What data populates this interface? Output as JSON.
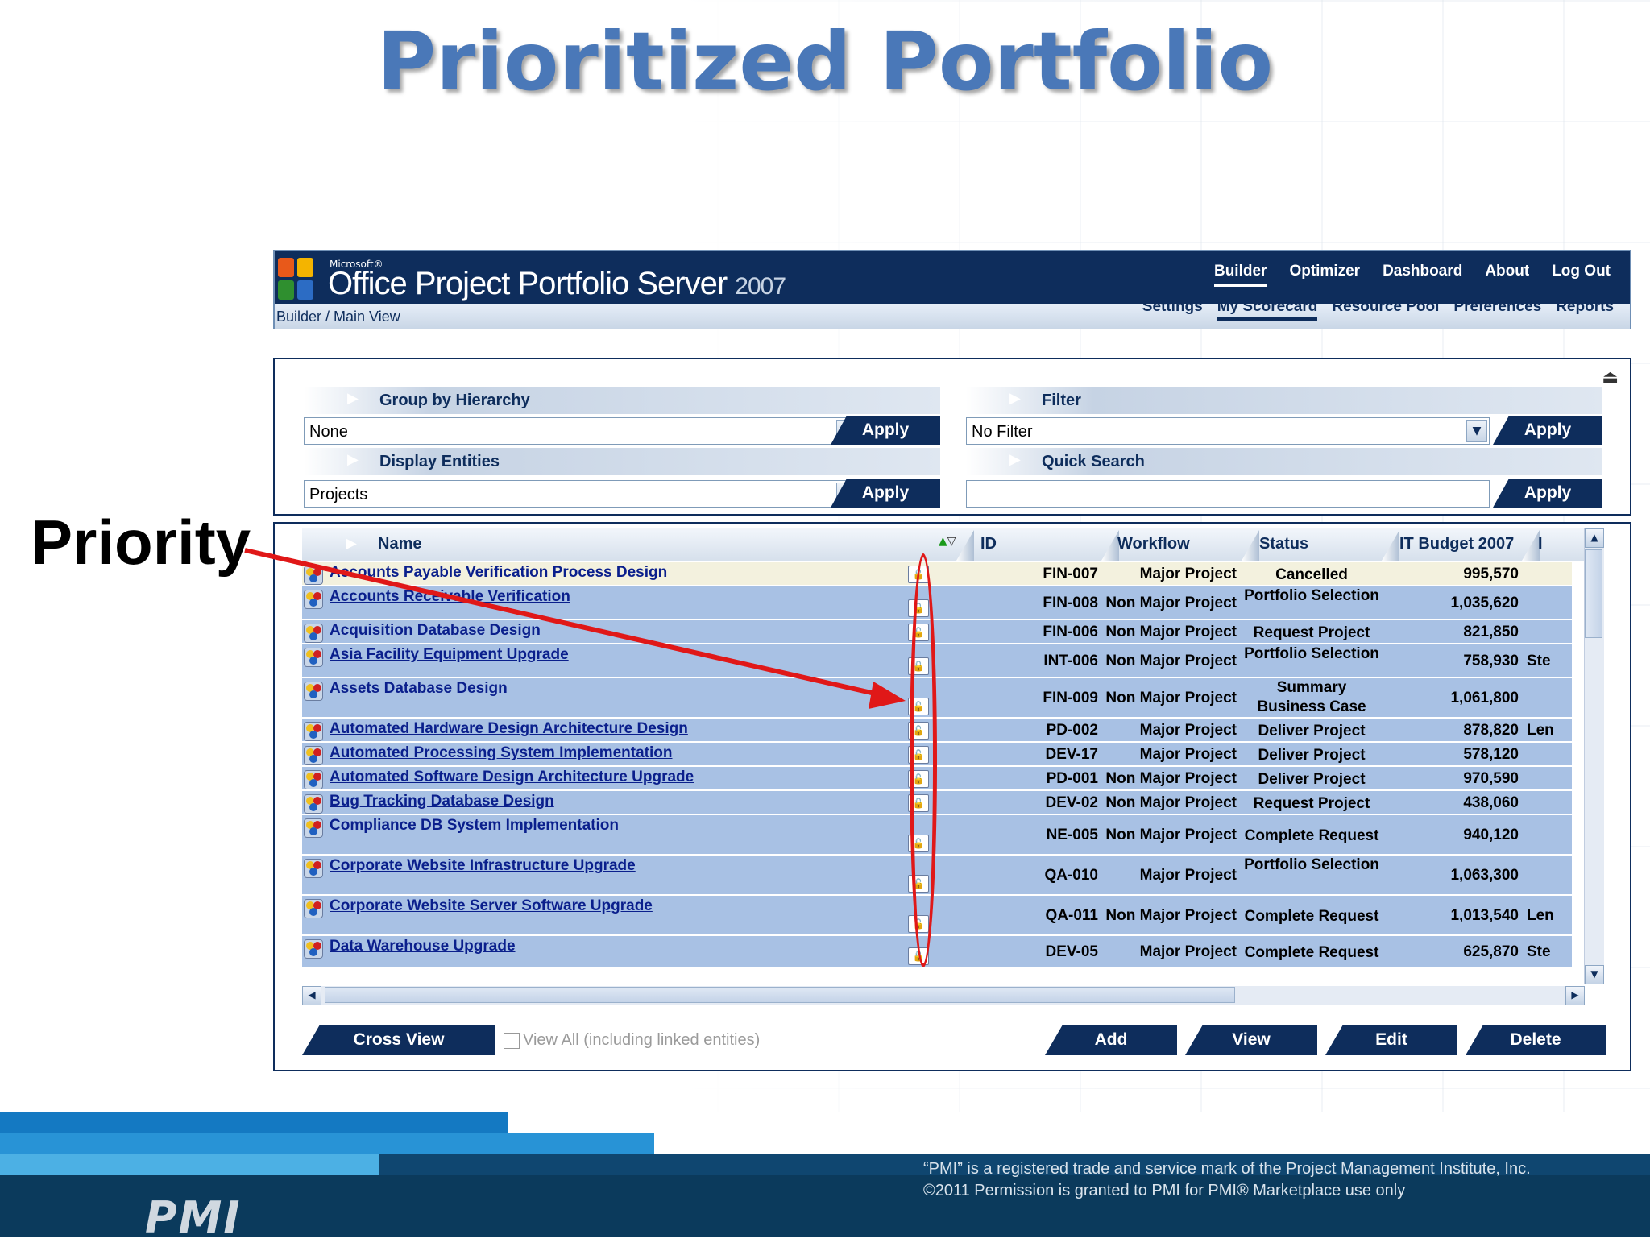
{
  "slide": {
    "title": "Prioritized Portfolio",
    "callout_label": "Priority",
    "footnote_line1": "“PMI” is a registered trade and service mark of the Project Management Institute, Inc.",
    "footnote_line2": "©2011 Permission is granted to PMI for PMI® Marketplace use only",
    "footer_logo": "PMI"
  },
  "app": {
    "vendor": "Microsoft®",
    "product": "Office Project Portfolio Server",
    "version": "2007",
    "breadcrumb": "Builder / Main View",
    "top_nav": [
      "Builder",
      "Optimizer",
      "Dashboard",
      "About",
      "Log Out"
    ],
    "top_nav_active": "Builder",
    "sub_nav": [
      "Settings",
      "My Scorecard",
      "Resource Pool",
      "Preferences",
      "Reports"
    ],
    "sub_nav_active": "My Scorecard"
  },
  "controls": {
    "group_by": {
      "label": "Group by Hierarchy",
      "value": "None",
      "apply": "Apply"
    },
    "filter": {
      "label": "Filter",
      "value": "No Filter",
      "apply": "Apply"
    },
    "display_entities": {
      "label": "Display Entities",
      "value": "Projects",
      "apply": "Apply"
    },
    "quick_search": {
      "label": "Quick Search",
      "value": "",
      "apply": "Apply"
    }
  },
  "grid": {
    "columns": [
      "Name",
      "ID",
      "Workflow",
      "Status",
      "IT Budget 2007",
      "I"
    ],
    "rows": [
      {
        "name": "Accounts Payable Verification Process Design",
        "id": "FIN-007",
        "workflow": "Major Project",
        "status": "Cancelled",
        "budget": "995,570",
        "extra": ""
      },
      {
        "name": "Accounts Receivable Verification",
        "id": "FIN-008",
        "workflow": "Non Major Project",
        "status": "Portfolio Selection",
        "budget": "1,035,620",
        "extra": ""
      },
      {
        "name": "Acquisition Database Design",
        "id": "FIN-006",
        "workflow": "Non Major Project",
        "status": "Request Project",
        "budget": "821,850",
        "extra": ""
      },
      {
        "name": "Asia Facility Equipment Upgrade",
        "id": "INT-006",
        "workflow": "Non Major Project",
        "status": "Portfolio Selection",
        "budget": "758,930",
        "extra": "Ste"
      },
      {
        "name": "Assets Database Design",
        "id": "FIN-009",
        "workflow": "Non Major Project",
        "status": "Summary Business Case",
        "budget": "1,061,800",
        "extra": ""
      },
      {
        "name": "Automated Hardware Design Architecture Design",
        "id": "PD-002",
        "workflow": "Major Project",
        "status": "Deliver Project",
        "budget": "878,820",
        "extra": "Len"
      },
      {
        "name": "Automated Processing System Implementation",
        "id": "DEV-17",
        "workflow": "Major Project",
        "status": "Deliver Project",
        "budget": "578,120",
        "extra": ""
      },
      {
        "name": "Automated Software Design Architecture Upgrade",
        "id": "PD-001",
        "workflow": "Non Major Project",
        "status": "Deliver Project",
        "budget": "970,590",
        "extra": ""
      },
      {
        "name": "Bug Tracking Database Design",
        "id": "DEV-02",
        "workflow": "Non Major Project",
        "status": "Request Project",
        "budget": "438,060",
        "extra": ""
      },
      {
        "name": "Compliance DB System Implementation",
        "id": "NE-005",
        "workflow": "Non Major Project",
        "status": "Complete Request",
        "budget": "940,120",
        "extra": ""
      },
      {
        "name": "Corporate Website Infrastructure Upgrade",
        "id": "QA-010",
        "workflow": "Major Project",
        "status": "Portfolio Selection",
        "budget": "1,063,300",
        "extra": ""
      },
      {
        "name": "Corporate Website Server Software Upgrade",
        "id": "QA-011",
        "workflow": "Non Major Project",
        "status": "Complete Request",
        "budget": "1,013,540",
        "extra": "Len"
      },
      {
        "name": "Data Warehouse Upgrade",
        "id": "DEV-05",
        "workflow": "Major Project",
        "status": "Complete Request",
        "budget": "625,870",
        "extra": "Ste"
      }
    ]
  },
  "actions": {
    "cross_view": "Cross View",
    "view_all": "View All (including linked entities)",
    "add": "Add",
    "view": "View",
    "edit": "Edit",
    "delete": "Delete"
  },
  "colors": {
    "brand_navy": "#0e2d5c",
    "row_blue": "#a8c1e4",
    "callout_red": "#e01818",
    "title_blue": "#4a78b8"
  }
}
